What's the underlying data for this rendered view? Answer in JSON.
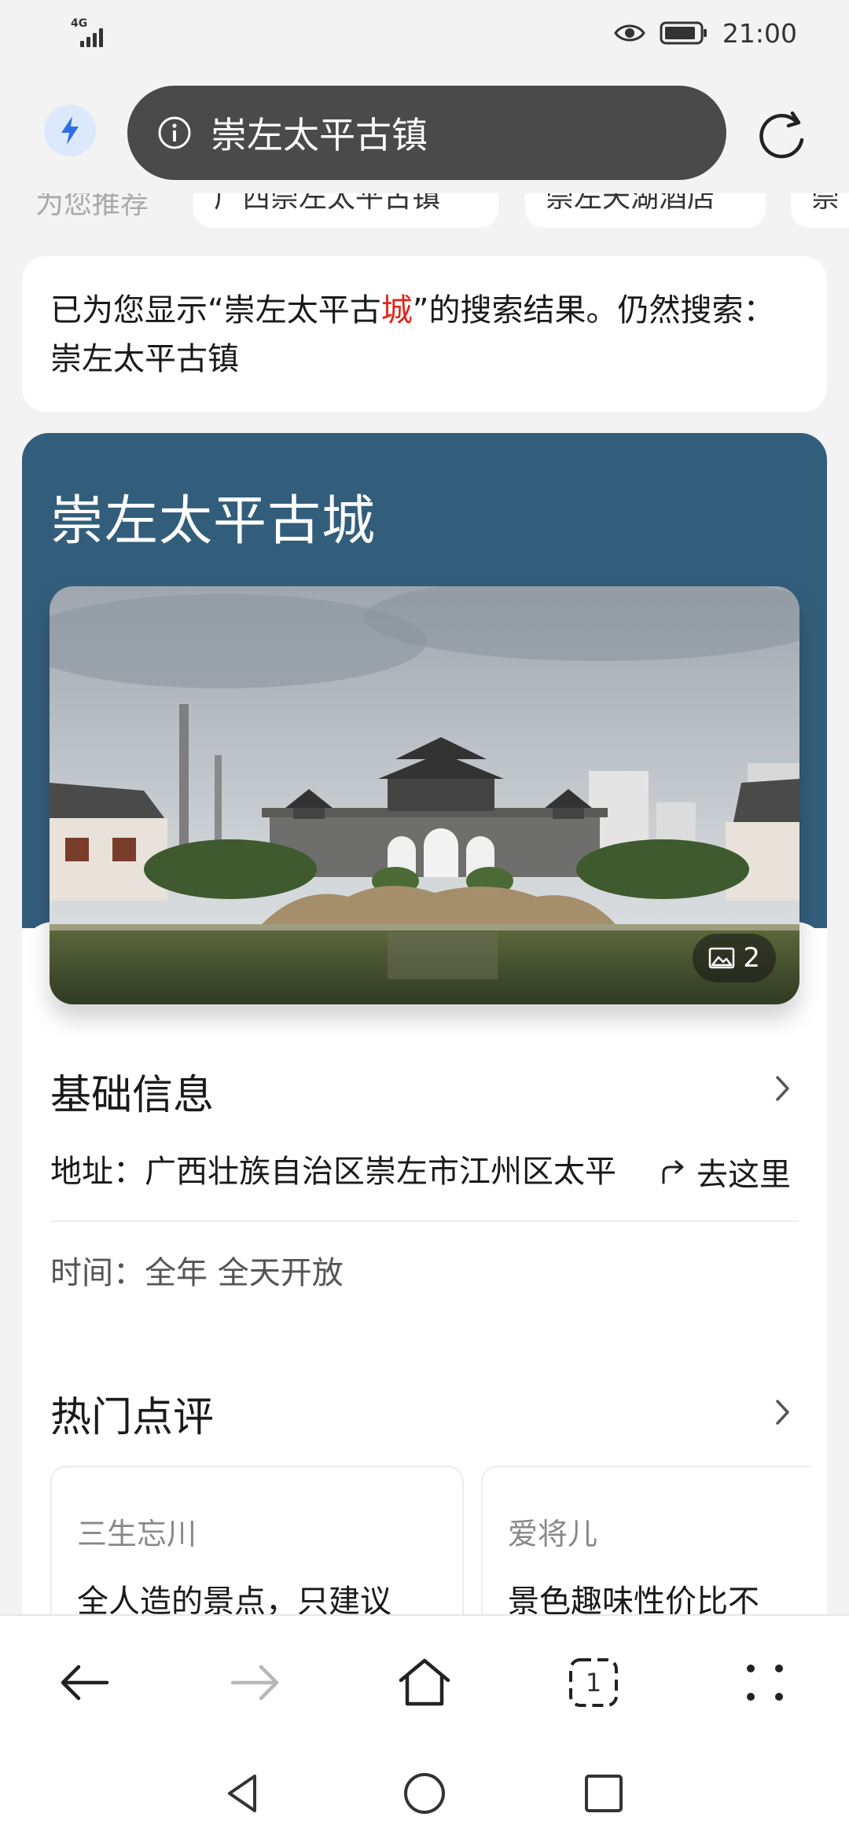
{
  "status_bar": {
    "network": "4G",
    "time": "21:00",
    "icons": [
      "signal-icon",
      "eye-icon",
      "battery-icon"
    ]
  },
  "browser": {
    "search_query": "崇左太平古镇",
    "icons": [
      "bolt-icon",
      "info-icon",
      "refresh-icon"
    ]
  },
  "suggestions": {
    "lead_label": "为您推荐",
    "chips": [
      "广西崇左太平古镇",
      "崇左天湖酒店",
      "崇"
    ]
  },
  "notice": {
    "prefix": "已为您显示“崇左太平古",
    "highlight": "城",
    "suffix": "”的搜索结果。仍然搜索：",
    "alt_query": "崇左太平古镇"
  },
  "attraction": {
    "title": "崇左太平古城",
    "photo_count": "2",
    "basic_info_title": "基础信息",
    "address_label": "地址：",
    "address_value": "广西壮族自治区崇左市江州区太平",
    "directions_label": "去这里",
    "hours_label": "时间：",
    "hours_value": "全年 全天开放",
    "reviews_title": "热门点评",
    "reviews": [
      {
        "user": "三生忘川",
        "text": "全人造的景点，只建议"
      },
      {
        "user": "爱将儿",
        "text": "景色趣味性价比不"
      }
    ]
  },
  "colors": {
    "header_blue": "#335e7b",
    "address_pill": "#4a4a4a",
    "highlight_red": "#e1251b",
    "bolt_blue": "#2f6fe6"
  }
}
